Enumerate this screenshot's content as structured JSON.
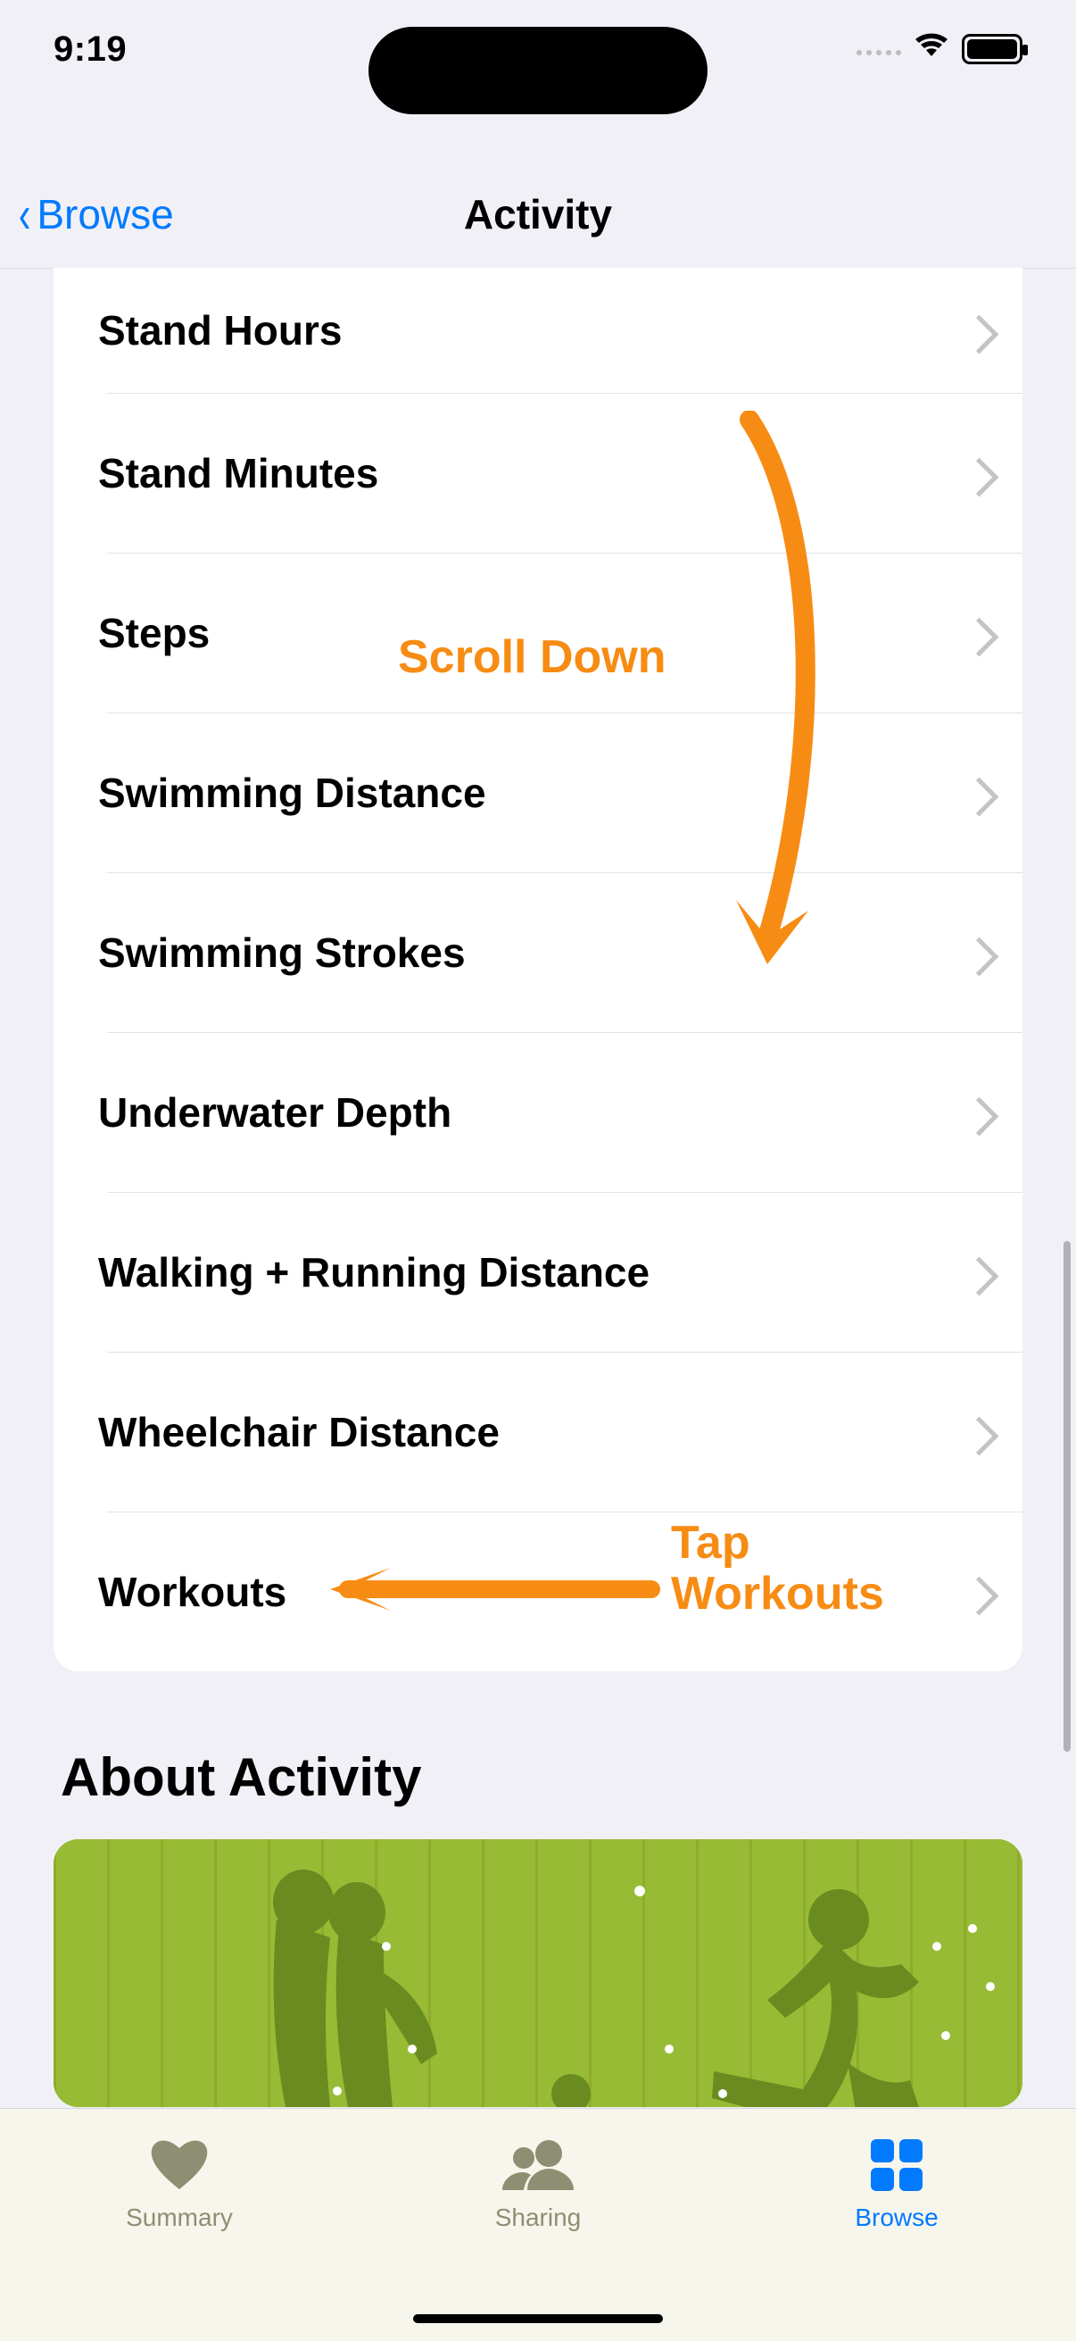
{
  "status": {
    "time": "9:19"
  },
  "nav": {
    "back_label": "Browse",
    "title": "Activity"
  },
  "activity_list": {
    "row0": "Stand Hours",
    "row1": "Stand Minutes",
    "row2": "Steps",
    "row3": "Swimming Distance",
    "row4": "Swimming Strokes",
    "row5": "Underwater Depth",
    "row6": "Walking + Running Distance",
    "row7": "Wheelchair Distance",
    "row8": "Workouts"
  },
  "section": {
    "about_title": "About Activity"
  },
  "tabs": {
    "summary": "Summary",
    "sharing": "Sharing",
    "browse": "Browse"
  },
  "annotations": {
    "scroll_text": "Scroll Down",
    "tap_text": "Tap\nWorkouts"
  },
  "colors": {
    "ios_blue": "#007aff",
    "annotation_orange": "#f78c14",
    "illustration_green": "#8fb92d"
  }
}
